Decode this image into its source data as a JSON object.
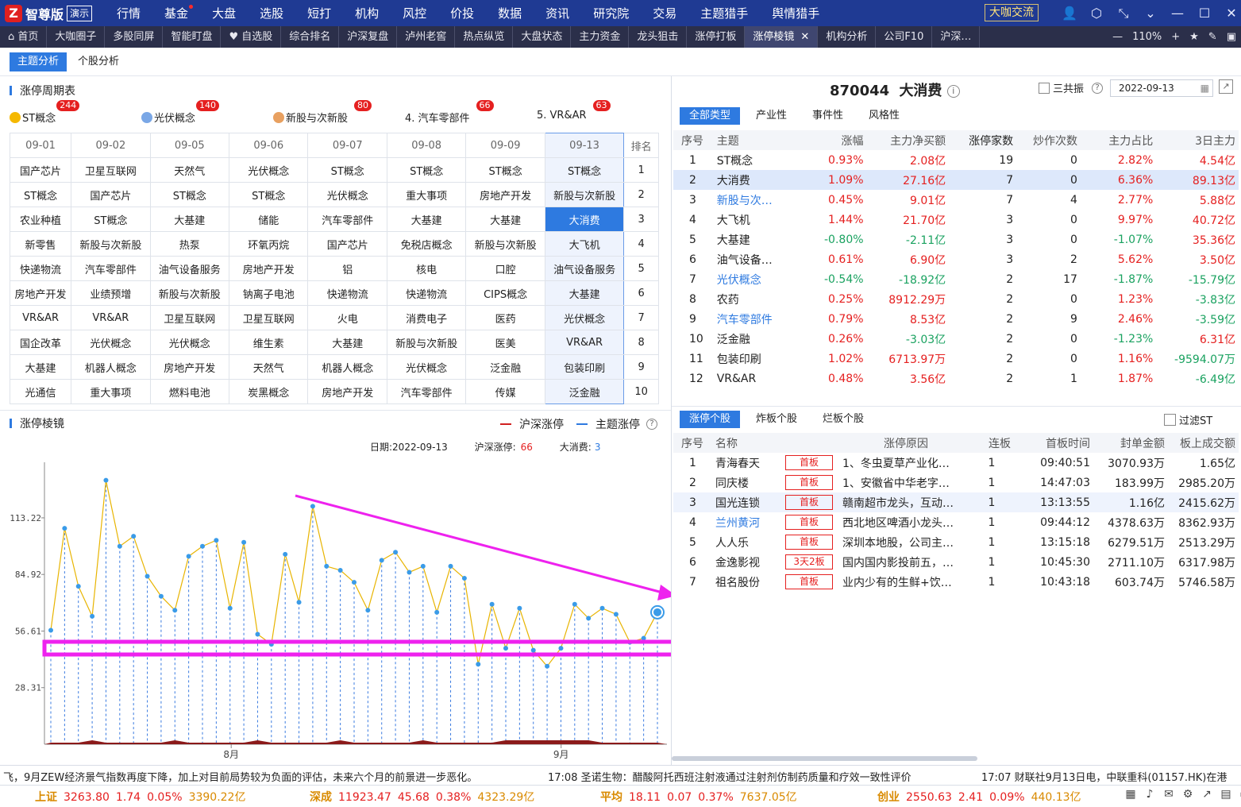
{
  "app": {
    "logo": "智尊版",
    "demo": "演示",
    "logo_mark": "Z"
  },
  "menu": [
    {
      "label": "行情"
    },
    {
      "label": "基金",
      "dot": true
    },
    {
      "label": "大盘"
    },
    {
      "label": "选股"
    },
    {
      "label": "短打"
    },
    {
      "label": "机构"
    },
    {
      "label": "风控"
    },
    {
      "label": "价投"
    },
    {
      "label": "数据"
    },
    {
      "label": "资讯"
    },
    {
      "label": "研究院"
    },
    {
      "label": "交易"
    },
    {
      "label": "主题猎手"
    },
    {
      "label": "舆情猎手"
    }
  ],
  "dk_button": "大咖交流",
  "tabs": [
    "首页",
    "大咖圈子",
    "多股同屏",
    "智能盯盘",
    "自选股",
    "综合排名",
    "沪深复盘",
    "泸州老窖",
    "热点纵览",
    "大盘状态",
    "主力资金",
    "龙头狙击",
    "涨停打板",
    "涨停棱镜",
    "机构分析",
    "公司F10",
    "沪深…"
  ],
  "active_tab": "涨停棱镜",
  "zoom": "110%",
  "subtabs": [
    "主题分析",
    "个股分析"
  ],
  "cycle": {
    "title": "涨停周期表",
    "legend": [
      {
        "label": "ST概念",
        "count": "244",
        "color": "#f5b800"
      },
      {
        "label": "光伏概念",
        "count": "140",
        "color": "#7aa7e6"
      },
      {
        "label": "新股与次新股",
        "count": "80",
        "color": "#e8a060"
      },
      {
        "label": "4. 汽车零部件",
        "count": "66"
      },
      {
        "label": "5. VR&AR",
        "count": "63"
      }
    ],
    "dates": [
      "09-01",
      "09-02",
      "09-05",
      "09-06",
      "09-07",
      "09-08",
      "09-09",
      "09-13"
    ],
    "rank_label": "排名",
    "rows": [
      [
        "国产芯片",
        "卫星互联网",
        "天然气",
        "光伏概念",
        "ST概念",
        "ST概念",
        "ST概念",
        "ST概念"
      ],
      [
        "ST概念",
        "国产芯片",
        "ST概念",
        "ST概念",
        "光伏概念",
        "重大事项",
        "房地产开发",
        "新股与次新股"
      ],
      [
        "农业种植",
        "ST概念",
        "大基建",
        "储能",
        "汽车零部件",
        "大基建",
        "大基建",
        "大消费"
      ],
      [
        "新零售",
        "新股与次新股",
        "热泵",
        "环氧丙烷",
        "国产芯片",
        "免税店概念",
        "新股与次新股",
        "大飞机"
      ],
      [
        "快递物流",
        "汽车零部件",
        "油气设备服务",
        "房地产开发",
        "铝",
        "核电",
        "口腔",
        "油气设备服务"
      ],
      [
        "房地产开发",
        "业绩预增",
        "新股与次新股",
        "钠离子电池",
        "快递物流",
        "快递物流",
        "CIPS概念",
        "大基建"
      ],
      [
        "VR&AR",
        "VR&AR",
        "卫星互联网",
        "卫星互联网",
        "火电",
        "消费电子",
        "医药",
        "光伏概念"
      ],
      [
        "国企改革",
        "光伏概念",
        "光伏概念",
        "维生素",
        "大基建",
        "新股与次新股",
        "医美",
        "VR&AR"
      ],
      [
        "大基建",
        "机器人概念",
        "房地产开发",
        "天然气",
        "机器人概念",
        "光伏概念",
        "泛金融",
        "包装印刷"
      ],
      [
        "光通信",
        "重大事项",
        "燃料电池",
        "炭黑概念",
        "房地产开发",
        "汽车零部件",
        "传媒",
        "泛金融"
      ]
    ],
    "ranks": [
      "1",
      "2",
      "3",
      "4",
      "5",
      "6",
      "7",
      "8",
      "9",
      "10"
    ]
  },
  "prism": {
    "title": "涨停棱镜",
    "legend_hs": "沪深涨停",
    "legend_theme": "主题涨停",
    "date_label": "日期:",
    "date": "2022-09-13",
    "hs_label": "沪深涨停:",
    "hs_value": "66",
    "theme_label": "大消费:",
    "theme_value": "3"
  },
  "chart_data": {
    "type": "line",
    "y_ticks": [
      "113.22",
      "84.92",
      "56.61",
      "28.31"
    ],
    "x_labels": [
      "8月",
      "9月"
    ],
    "ylim": [
      0,
      141
    ],
    "series": [
      {
        "values": [
          57,
          108,
          79,
          64,
          132,
          99,
          104,
          84,
          74,
          67,
          94,
          99,
          102,
          68,
          101,
          55,
          50,
          95,
          71,
          119,
          89,
          87,
          81,
          67,
          92,
          96,
          86,
          89,
          66,
          89,
          83,
          40,
          70,
          48,
          68,
          47,
          39,
          48,
          70,
          63,
          68,
          65,
          51,
          53,
          66
        ]
      }
    ]
  },
  "right_top": {
    "code": "870044",
    "name": "大消费",
    "sangong": "三共振",
    "date": "2022-09-13",
    "filters": [
      "全部类型",
      "产业性",
      "事件性",
      "风格性"
    ],
    "headers": [
      "序号",
      "主题",
      "涨幅",
      "主力净买额",
      "涨停家数",
      "炒作次数",
      "主力占比",
      "3日主力"
    ],
    "rows": [
      [
        "1",
        "ST概念",
        "0.93%",
        "2.08亿",
        "19",
        "0",
        "2.82%",
        "4.54亿"
      ],
      [
        "2",
        "大消费",
        "1.09%",
        "27.16亿",
        "7",
        "0",
        "6.36%",
        "89.13亿"
      ],
      [
        "3",
        "新股与次…",
        "0.45%",
        "9.01亿",
        "7",
        "4",
        "2.77%",
        "5.88亿"
      ],
      [
        "4",
        "大飞机",
        "1.44%",
        "21.70亿",
        "3",
        "0",
        "9.97%",
        "40.72亿"
      ],
      [
        "5",
        "大基建",
        "-0.80%",
        "-2.11亿",
        "3",
        "0",
        "-1.07%",
        "35.36亿"
      ],
      [
        "6",
        "油气设备…",
        "0.61%",
        "6.90亿",
        "3",
        "2",
        "5.62%",
        "3.50亿"
      ],
      [
        "7",
        "光伏概念",
        "-0.54%",
        "-18.92亿",
        "2",
        "17",
        "-1.87%",
        "-15.79亿"
      ],
      [
        "8",
        "农药",
        "0.25%",
        "8912.29万",
        "2",
        "0",
        "1.23%",
        "-3.83亿"
      ],
      [
        "9",
        "汽车零部件",
        "0.79%",
        "8.53亿",
        "2",
        "9",
        "2.46%",
        "-3.59亿"
      ],
      [
        "10",
        "泛金融",
        "0.26%",
        "-3.03亿",
        "2",
        "0",
        "-1.23%",
        "6.31亿"
      ],
      [
        "11",
        "包装印刷",
        "1.02%",
        "6713.97万",
        "2",
        "0",
        "1.16%",
        "-9594.07万"
      ],
      [
        "12",
        "VR&AR",
        "0.48%",
        "3.56亿",
        "2",
        "1",
        "1.87%",
        "-6.49亿"
      ]
    ]
  },
  "right_bottom": {
    "tabs": [
      "涨停个股",
      "炸板个股",
      "烂板个股"
    ],
    "filter_st": "过滤ST",
    "headers": [
      "序号",
      "名称",
      "",
      "涨停原因",
      "连板",
      "首板时间",
      "封单金额",
      "板上成交额"
    ],
    "rows": [
      [
        "1",
        "青海春天",
        "首板",
        "1、冬虫夏草产业化…",
        "1",
        "09:40:51",
        "3070.93万",
        "1.65亿"
      ],
      [
        "2",
        "同庆楼",
        "首板",
        "1、安徽省中华老字…",
        "1",
        "14:47:03",
        "183.99万",
        "2985.20万"
      ],
      [
        "3",
        "国光连锁",
        "首板",
        "赣南超市龙头，互动…",
        "1",
        "13:13:55",
        "1.16亿",
        "2415.62万"
      ],
      [
        "4",
        "兰州黄河",
        "首板",
        "西北地区啤酒小龙头…",
        "1",
        "09:44:12",
        "4378.63万",
        "8362.93万"
      ],
      [
        "5",
        "人人乐",
        "首板",
        "深圳本地股，公司主…",
        "1",
        "13:15:18",
        "6279.51万",
        "2513.29万"
      ],
      [
        "6",
        "金逸影视",
        "3天2板",
        "国内国内影投前五，…",
        "1",
        "10:45:30",
        "2711.10万",
        "6317.98万"
      ],
      [
        "7",
        "祖名股份",
        "首板",
        "业内少有的生鲜+饮…",
        "1",
        "10:43:18",
        "603.74万",
        "5746.58万"
      ]
    ]
  },
  "ticker": [
    "飞，9月ZEW经济景气指数再度下降，加上对目前局势较为负面的评估，未来六个月的前景进一步恶化。",
    "17:08  圣诺生物：醋酸阿托西班注射液通过注射剂仿制药质量和疗效一致性评价",
    "17:07  财联社9月13日电，中联重科(01157.HK)在港"
  ],
  "indices": [
    {
      "name": "上证",
      "price": "3263.80",
      "chg": "1.74",
      "pct": "0.05%",
      "amt": "3390.22亿"
    },
    {
      "name": "深成",
      "price": "11923.47",
      "chg": "45.68",
      "pct": "0.38%",
      "amt": "4323.29亿"
    },
    {
      "name": "平均",
      "price": "18.11",
      "chg": "0.07",
      "pct": "0.37%",
      "amt": "7637.05亿"
    },
    {
      "name": "创业",
      "price": "2550.63",
      "chg": "2.41",
      "pct": "0.09%",
      "amt": "440.13亿"
    }
  ]
}
